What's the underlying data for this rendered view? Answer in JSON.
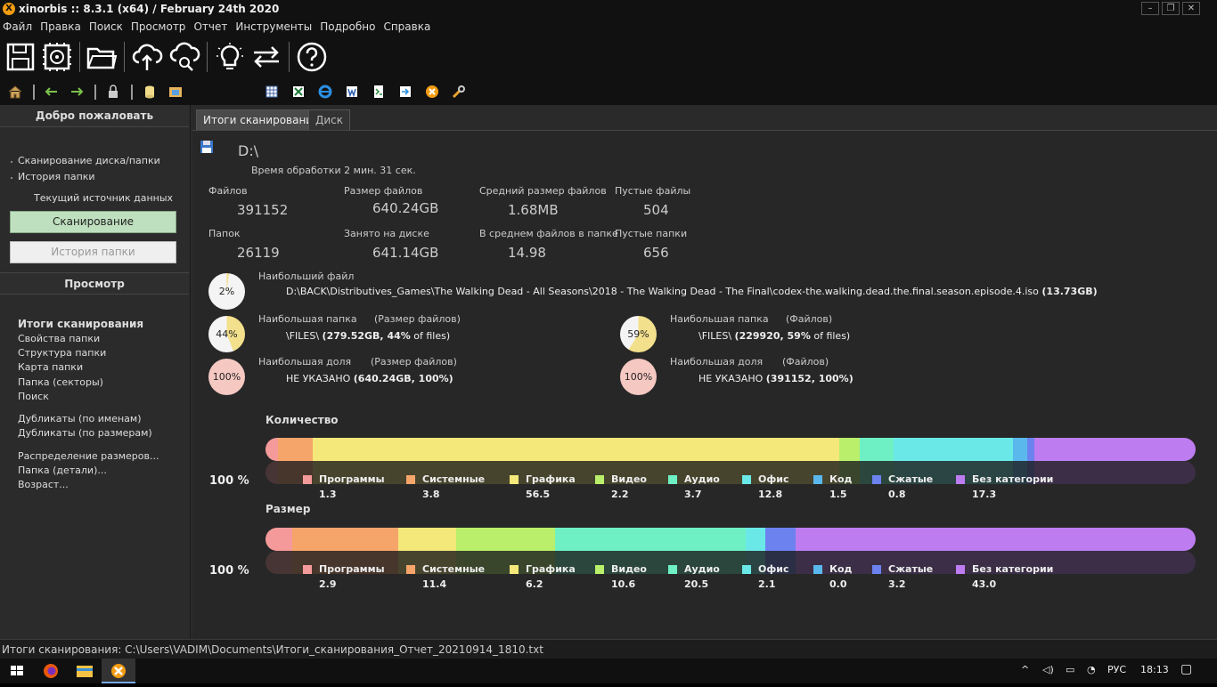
{
  "window": {
    "title": "xinorbis :: 8.3.1 (x64) / February 24th 2020",
    "app_icon": "x-logo-icon"
  },
  "menu": [
    "Файл",
    "Правка",
    "Поиск",
    "Просмотр",
    "Отчет",
    "Инструменты",
    "Подробно",
    "Справка"
  ],
  "toolbar_big": [
    "save-icon",
    "settings-chip-icon",
    "open-folder-icon",
    "cloud-upload-icon",
    "cloud-search-icon",
    "lightbulb-icon",
    "swap-arrows-icon",
    "help-icon"
  ],
  "toolbar_small": [
    "home-icon",
    "back-arrow-icon",
    "forward-arrow-icon",
    "lock-icon",
    "database-icon",
    "folder-picture-icon",
    "table-icon",
    "excel-icon",
    "ie-icon",
    "word-icon",
    "xml-icon",
    "export-icon",
    "xinorbis-icon",
    "tools-icon"
  ],
  "sidebar": {
    "welcome_header": "Добро пожаловать",
    "welcome_items": [
      "Сканирование диска/папки",
      "История папки"
    ],
    "current_source_label": "Текущий источник данных",
    "scan_button": "Сканирование",
    "history_button": "История папки",
    "view_header": "Просмотр",
    "view_items": [
      "Итоги сканирования",
      "Свойства папки",
      "Структура папки",
      "Карта папки",
      "Папка (секторы)",
      "Поиск",
      "Дубликаты (по именам)",
      "Дубликаты (по размерам)",
      "Распределение размеров...",
      "Папка (детали)...",
      "Возраст..."
    ]
  },
  "tabs": [
    "Итоги сканирования",
    "Диск"
  ],
  "summary": {
    "path": "D:\\",
    "time": "Время обработки 2 мин. 31 сек.",
    "stats": [
      {
        "label": "Файлов",
        "value": "391152"
      },
      {
        "label": "Размер файлов",
        "value": "640.24GB"
      },
      {
        "label": "Средний размер файлов",
        "value": "1.68MB"
      },
      {
        "label": "Пустые файлы",
        "value": "504"
      },
      {
        "label": "Папок",
        "value": "26119"
      },
      {
        "label": "Занято на диске",
        "value": "641.14GB"
      },
      {
        "label": "В среднем файлов в папке",
        "value": "14.98"
      },
      {
        "label": "Пустые папки",
        "value": "656"
      }
    ],
    "largest_file": {
      "label": "Наибольший файл",
      "pct": "2%",
      "pct_value": 2,
      "path": "D:\\BACK\\Distributives_Games\\The Walking Dead - All Seasons\\2018 - The Walking Dead - The Final\\codex-the.walking.dead.the.final.season.episode.4.iso",
      "size": "(13.73GB)"
    },
    "largest_folder_size": {
      "label": "Наибольшая папка",
      "sub": "(Размер файлов)",
      "pct": "44%",
      "pct_value": 44,
      "name": "\\FILES\\",
      "detail_bold": "(279.52GB, 44%",
      "detail_tail": " of files)"
    },
    "largest_folder_files": {
      "label": "Наибольшая папка",
      "sub": "(Файлов)",
      "pct": "59%",
      "pct_value": 59,
      "name": "\\FILES\\",
      "detail_bold": "(229920, 59%",
      "detail_tail": " of files)"
    },
    "largest_share_size": {
      "label": "Наибольшая доля",
      "sub": "(Размер файлов)",
      "pct": "100%",
      "pct_value": 100,
      "name": "НЕ УКАЗАНО",
      "detail_bold": "(640.24GB, 100%)"
    },
    "largest_share_files": {
      "label": "Наибольшая доля",
      "sub": "(Файлов)",
      "pct": "100%",
      "pct_value": 100,
      "name": "НЕ УКАЗАНО",
      "detail_bold": "(391152, 100%)"
    }
  },
  "chart_data": [
    {
      "type": "bar",
      "title": "Количество",
      "total_label": "100 %",
      "categories": [
        "Программы",
        "Системные",
        "Графика",
        "Видео",
        "Аудио",
        "Офис",
        "Код",
        "Сжатые",
        "Без категории"
      ],
      "values": [
        1.3,
        3.8,
        56.5,
        2.2,
        3.7,
        12.8,
        1.5,
        0.8,
        17.3
      ],
      "colors": [
        "#f59a9a",
        "#f5a56a",
        "#f4e87a",
        "#b9ef6a",
        "#6ef0c4",
        "#6ae8e8",
        "#5ab8ec",
        "#6c82ef",
        "#bd7cf0"
      ]
    },
    {
      "type": "bar",
      "title": "Размер",
      "total_label": "100 %",
      "categories": [
        "Программы",
        "Системные",
        "Графика",
        "Видео",
        "Аудио",
        "Офис",
        "Код",
        "Сжатые",
        "Без категории"
      ],
      "values": [
        2.9,
        11.4,
        6.2,
        10.6,
        20.5,
        2.1,
        0.0,
        3.2,
        43.0
      ],
      "colors": [
        "#f59a9a",
        "#f5a56a",
        "#f4e87a",
        "#b9ef6a",
        "#6ef0c4",
        "#6ae8e8",
        "#5ab8ec",
        "#6c82ef",
        "#bd7cf0"
      ]
    }
  ],
  "status": "Итоги сканирования: C:\\Users\\VADIM\\Documents\\Итоги_сканирования_Отчет_20210914_1810.txt",
  "taskbar": {
    "lang": "РУС",
    "time": "18:13"
  }
}
